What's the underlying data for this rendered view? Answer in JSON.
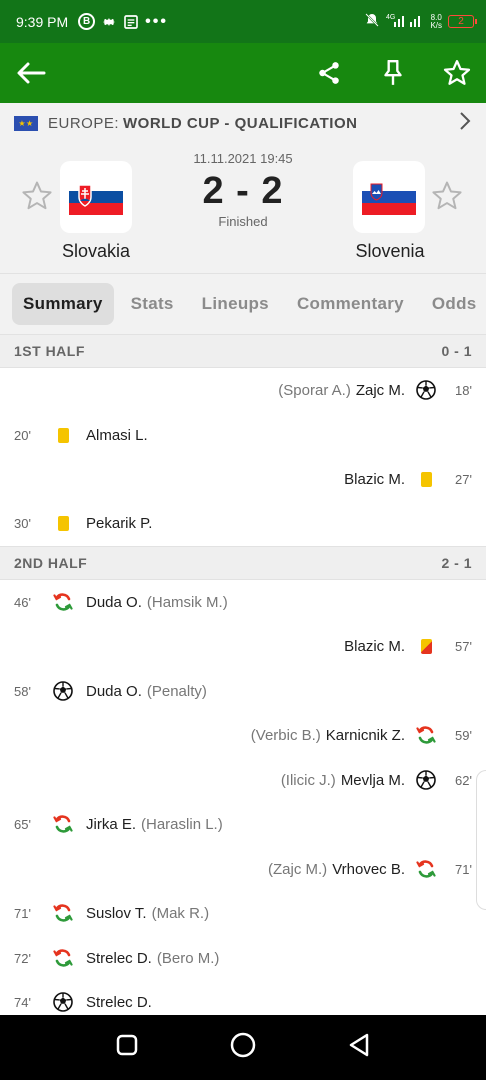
{
  "status_bar": {
    "time": "9:39 PM",
    "b_badge": "B",
    "dots": "•••",
    "net_speed_top": "8.0",
    "net_speed_bottom": "K/s",
    "signal": "4G",
    "battery": "2"
  },
  "app_bar": {
    "back_icon": "arrow-left-icon",
    "share_icon": "share-icon",
    "pin_icon": "pin-icon",
    "favorite_icon": "star-outline-icon"
  },
  "competition": {
    "region": "EUROPE:",
    "name": "WORLD CUP - QUALIFICATION"
  },
  "match": {
    "datetime": "11.11.2021 19:45",
    "score": "2 - 2",
    "status": "Finished",
    "home": {
      "name": "Slovakia"
    },
    "away": {
      "name": "Slovenia"
    }
  },
  "tabs": [
    "Summary",
    "Stats",
    "Lineups",
    "Commentary",
    "Odds"
  ],
  "halves": [
    {
      "label": "1ST HALF",
      "score": "0 - 1"
    },
    {
      "label": "2ND HALF",
      "score": "2 - 1"
    }
  ],
  "incidents": [
    {
      "side": "away",
      "minute": "18'",
      "type": "goal",
      "player": "Zajc M.",
      "assist": "(Sporar A.)"
    },
    {
      "side": "home",
      "minute": "20'",
      "type": "yellow",
      "player": "Almasi L.",
      "assist": ""
    },
    {
      "side": "away",
      "minute": "27'",
      "type": "yellow",
      "player": "Blazic M.",
      "assist": ""
    },
    {
      "side": "home",
      "minute": "30'",
      "type": "yellow",
      "player": "Pekarik P.",
      "assist": ""
    },
    {
      "side": "home",
      "minute": "46'",
      "type": "sub",
      "player": "Duda O.",
      "assist": "(Hamsik M.)"
    },
    {
      "side": "away",
      "minute": "57'",
      "type": "second-yellow",
      "player": "Blazic M.",
      "assist": ""
    },
    {
      "side": "home",
      "minute": "58'",
      "type": "goal",
      "player": "Duda O.",
      "assist": "(Penalty)"
    },
    {
      "side": "away",
      "minute": "59'",
      "type": "sub",
      "player": "Karnicnik Z.",
      "assist": "(Verbic B.)"
    },
    {
      "side": "away",
      "minute": "62'",
      "type": "goal",
      "player": "Mevlja M.",
      "assist": "(Ilicic J.)"
    },
    {
      "side": "home",
      "minute": "65'",
      "type": "sub",
      "player": "Jirka E.",
      "assist": "(Haraslin L.)"
    },
    {
      "side": "away",
      "minute": "71'",
      "type": "sub",
      "player": "Vrhovec B.",
      "assist": "(Zajc M.)"
    },
    {
      "side": "home",
      "minute": "71'",
      "type": "sub",
      "player": "Suslov T.",
      "assist": "(Mak R.)"
    },
    {
      "side": "home",
      "minute": "72'",
      "type": "sub",
      "player": "Strelec D.",
      "assist": "(Bero M.)"
    },
    {
      "side": "home",
      "minute": "74'",
      "type": "goal",
      "player": "Strelec D.",
      "assist": ""
    }
  ],
  "colors": {
    "primary_green": "#17880f",
    "status_green": "#127518",
    "yellow_card": "#f5c400",
    "red_card": "#e5341f",
    "sub_green": "#2e9a3a",
    "sub_red": "#e5341f"
  }
}
